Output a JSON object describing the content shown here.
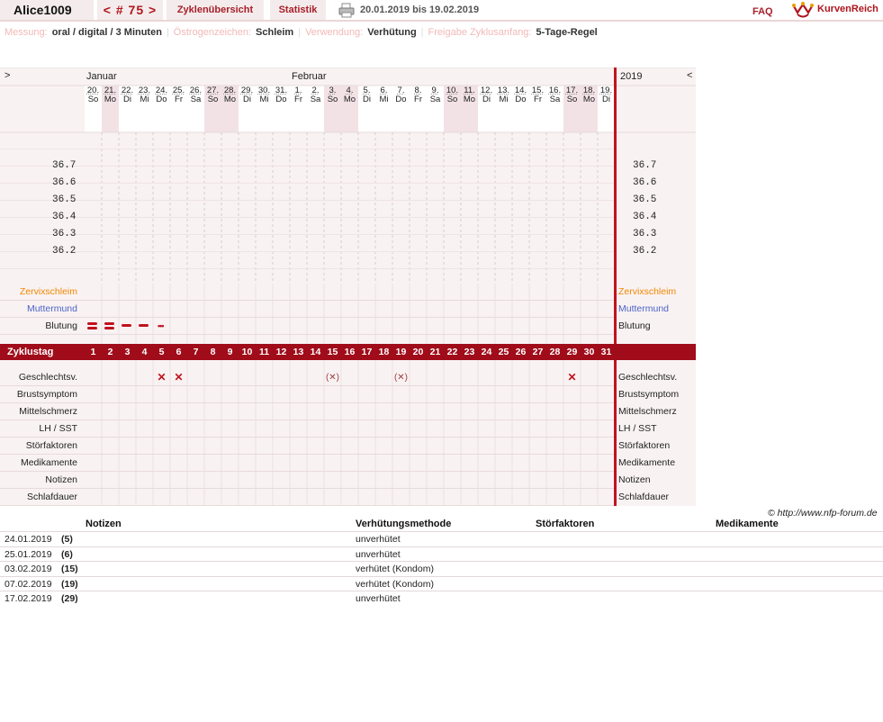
{
  "top": {
    "user": "Alice1009",
    "cycle": "< # 75 >",
    "tab_overview": "Zyklenübersicht",
    "tab_stats": "Statistik",
    "date_range": "20.01.2019 bis 19.02.2019",
    "faq": "FAQ",
    "logo_text": "KurvenReich"
  },
  "info": [
    {
      "label": "Messung:",
      "value": "oral / digital / 3 Minuten"
    },
    {
      "label": "Östrogenzeichen:",
      "value": "Schleim"
    },
    {
      "label": "Verwendung:",
      "value": "Verhütung"
    },
    {
      "label": "Freigabe Zyklusanfang:",
      "value": "5-Tage-Regel"
    }
  ],
  "chart": {
    "nav_left": ">",
    "nav_right": "<",
    "month1": "Januar",
    "month2": "Februar",
    "year": "2019",
    "days": [
      [
        "20.",
        "So"
      ],
      [
        "21.",
        "Mo"
      ],
      [
        "22.",
        "Di"
      ],
      [
        "23.",
        "Mi"
      ],
      [
        "24.",
        "Do"
      ],
      [
        "25.",
        "Fr"
      ],
      [
        "26.",
        "Sa"
      ],
      [
        "27.",
        "So"
      ],
      [
        "28.",
        "Mo"
      ],
      [
        "29.",
        "Di"
      ],
      [
        "30.",
        "Mi"
      ],
      [
        "31.",
        "Do"
      ],
      [
        "1.",
        "Fr"
      ],
      [
        "2.",
        "Sa"
      ],
      [
        "3.",
        "So"
      ],
      [
        "4.",
        "Mo"
      ],
      [
        "5.",
        "Di"
      ],
      [
        "6.",
        "Mi"
      ],
      [
        "7.",
        "Do"
      ],
      [
        "8.",
        "Fr"
      ],
      [
        "9.",
        "Sa"
      ],
      [
        "10.",
        "So"
      ],
      [
        "11.",
        "Mo"
      ],
      [
        "12.",
        "Di"
      ],
      [
        "13.",
        "Mi"
      ],
      [
        "14.",
        "Do"
      ],
      [
        "15.",
        "Fr"
      ],
      [
        "16.",
        "Sa"
      ],
      [
        "17.",
        "So"
      ],
      [
        "18.",
        "Mo"
      ],
      [
        "19.",
        "Di"
      ]
    ],
    "weekend_days": [
      1,
      7,
      8,
      14,
      15,
      21,
      22,
      28,
      29
    ],
    "temps": [
      "36.7",
      "36.6",
      "36.5",
      "36.4",
      "36.3",
      "36.2"
    ],
    "rows_top": [
      "Zervixschleim",
      "Muttermund",
      "Blutung"
    ],
    "cycle_label": "Zyklustag",
    "cycle_days": [
      1,
      2,
      3,
      4,
      5,
      6,
      7,
      8,
      9,
      10,
      11,
      12,
      13,
      14,
      15,
      16,
      17,
      18,
      19,
      20,
      21,
      22,
      23,
      24,
      25,
      26,
      27,
      28,
      29,
      30,
      31
    ],
    "rows_bottom": [
      "Geschlechtsv.",
      "Brustsymptom",
      "Mittelschmerz",
      "LH / SST",
      "Störfaktoren",
      "Medikamente",
      "Notizen",
      "Schlafdauer"
    ],
    "intercourse": [
      {
        "day": 5,
        "mark": "✕"
      },
      {
        "day": 6,
        "mark": "✕"
      },
      {
        "day": 15,
        "mark": "(✕)"
      },
      {
        "day": 19,
        "mark": "(✕)"
      },
      {
        "day": 29,
        "mark": "✕"
      }
    ],
    "bleeding": [
      {
        "day": 1,
        "level": "heavy"
      },
      {
        "day": 2,
        "level": "heavy"
      },
      {
        "day": 3,
        "level": "normal"
      },
      {
        "day": 4,
        "level": "normal"
      },
      {
        "day": 5,
        "level": "spotting"
      }
    ],
    "colors": {
      "accent": "#a00c1a",
      "weekend": "#f2e2e6",
      "grid": "#e7dbdb",
      "line": "#c0131f"
    }
  },
  "copyright": "© http://www.nfp-forum.de",
  "notes": {
    "h_notes": "Notizen",
    "h_method": "Verhütungsmethode",
    "h_disturb": "Störfaktoren",
    "h_meds": "Medikamente",
    "rows": [
      {
        "date": "24.01.2019",
        "day": "(5)",
        "method": "unverhütet"
      },
      {
        "date": "25.01.2019",
        "day": "(6)",
        "method": "unverhütet"
      },
      {
        "date": "03.02.2019",
        "day": "(15)",
        "method": "verhütet (Kondom)"
      },
      {
        "date": "07.02.2019",
        "day": "(19)",
        "method": "verhütet (Kondom)"
      },
      {
        "date": "17.02.2019",
        "day": "(29)",
        "method": "unverhütet"
      }
    ]
  }
}
